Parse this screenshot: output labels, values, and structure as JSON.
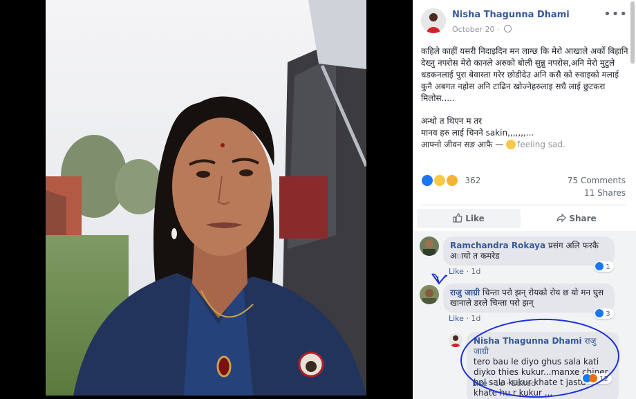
{
  "post": {
    "author": "Nisha Thagunna Dhami",
    "date": "October 20 ·",
    "text_p1": "कहिले काहीं यसरी निदाइदिन मन लाग्छ कि मेरो आखाले अर्को बिहानि देख्नु नपरोस मेरो कानले अरुको बोली सुन्नु नपरोस,अनि मेरो मुटुले धडकनलाई पुरा बेवास्ता गरेर छोडीदेउ अनि कसै को रुवाइको मलाई कुनै अबगत नहोस अनि टाढिन खोज्नेहरुलाइ सधै लाई छुटकरा मिलोस.....",
    "text_l1": "अन्धो त थिएन म तर",
    "text_l2": "मानव हरु लाई चिनने sakin,,,,,,,...",
    "text_l3": "आफ्नो जीवन सङ आफै —",
    "feeling": "feeling sad."
  },
  "stats": {
    "reactions": "362",
    "comments": "75 Comments",
    "shares": "11 Shares"
  },
  "actions": {
    "like": "Like",
    "share": "Share"
  },
  "comments": [
    {
      "name": "Ramchandra Rokaya",
      "text": "प्रसंग अलि फरकै अायो त कमरेड",
      "like": "Like",
      "time": "· 1d",
      "reacts": "1"
    },
    {
      "name": "राजु जाग्री",
      "text": "चिन्ता परो झन् रोयको रोय छ यो मन घुस खानाले डरले चिन्ता परो झन्",
      "like": "Like",
      "time": "· 1d",
      "reacts": "3"
    },
    {
      "name": "Nisha Thagunna Dhami",
      "tag": "राजु जाग्री",
      "text": "tero bau le diyo ghus sala kati diyko thies kukur...manxe chiner bol sala kukur khate t jasto khate hu r kukur ...",
      "like": "Like",
      "time": "· 1d ·",
      "edited": "Edited",
      "reacts": "12"
    }
  ],
  "colors": {
    "link": "#365899",
    "accent_blue": "#1877f2",
    "annotation": "#1c2fd8"
  }
}
